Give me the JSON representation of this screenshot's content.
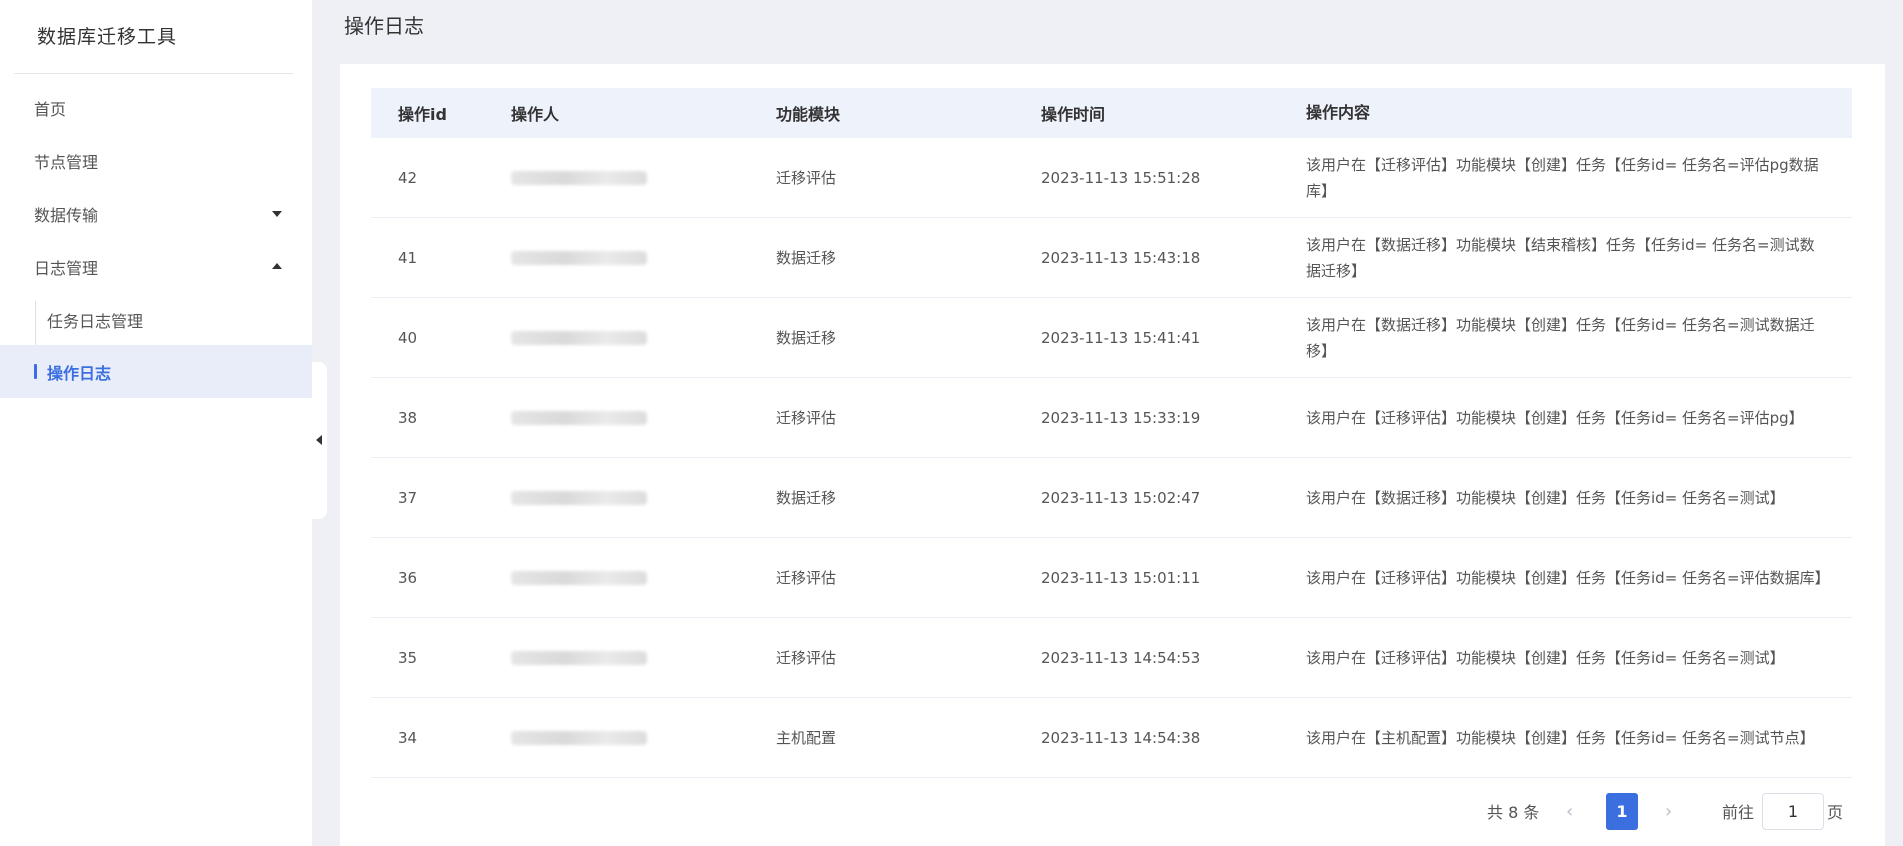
{
  "app_title": "数据库迁移工具",
  "sidebar": {
    "items": [
      {
        "label": "首页"
      },
      {
        "label": "节点管理"
      },
      {
        "label": "数据传输"
      },
      {
        "label": "日志管理"
      }
    ],
    "sub_items": [
      {
        "label": "任务日志管理"
      },
      {
        "label": "操作日志"
      }
    ]
  },
  "page_title": "操作日志",
  "table": {
    "columns": [
      "操作id",
      "操作人",
      "功能模块",
      "操作时间",
      "操作内容"
    ],
    "rows": [
      {
        "id": "42",
        "module": "迁移评估",
        "time": "2023-11-13 15:51:28",
        "content": "该用户在【迁移评估】功能模块【创建】任务【任务id=      任务名=评估pg数据库】"
      },
      {
        "id": "41",
        "module": "数据迁移",
        "time": "2023-11-13 15:43:18",
        "content": "该用户在【数据迁移】功能模块【结束稽核】任务【任务id=      任务名=测试数据迁移】"
      },
      {
        "id": "40",
        "module": "数据迁移",
        "time": "2023-11-13 15:41:41",
        "content": "该用户在【数据迁移】功能模块【创建】任务【任务id=      任务名=测试数据迁移】"
      },
      {
        "id": "38",
        "module": "迁移评估",
        "time": "2023-11-13 15:33:19",
        "content": "该用户在【迁移评估】功能模块【创建】任务【任务id=      任务名=评估pg】"
      },
      {
        "id": "37",
        "module": "数据迁移",
        "time": "2023-11-13 15:02:47",
        "content": "该用户在【数据迁移】功能模块【创建】任务【任务id=      任务名=测试】"
      },
      {
        "id": "36",
        "module": "迁移评估",
        "time": "2023-11-13 15:01:11",
        "content": "该用户在【迁移评估】功能模块【创建】任务【任务id=      任务名=评估数据库】"
      },
      {
        "id": "35",
        "module": "迁移评估",
        "time": "2023-11-13 14:54:53",
        "content": "该用户在【迁移评估】功能模块【创建】任务【任务id=      任务名=测试】"
      },
      {
        "id": "34",
        "module": "主机配置",
        "time": "2023-11-13 14:54:38",
        "content": "该用户在【主机配置】功能模块【创建】任务【任务id=      任务名=测试节点】"
      }
    ]
  },
  "pagination": {
    "total_text": "共 8 条",
    "prev_icon": "‹",
    "current_page": "1",
    "next_icon": "›",
    "goto_label": "前往",
    "goto_value": "1",
    "goto_suffix": "页"
  }
}
